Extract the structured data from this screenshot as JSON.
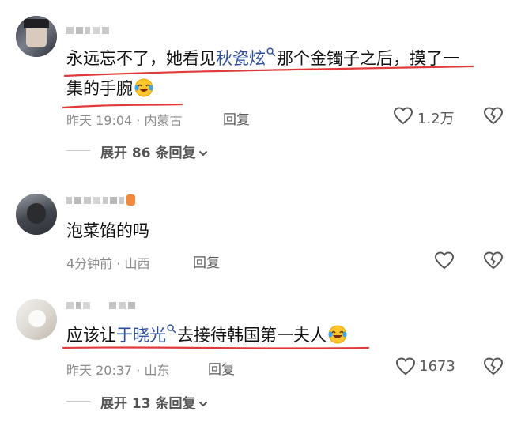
{
  "comments": [
    {
      "text_before": "永远忘不了，她看见",
      "link": "秋瓷炫",
      "text_after_line1": "那个金镯子之后，摸了一",
      "text_line2": "集的手腕",
      "time": "昨天 19:04",
      "location": "内蒙古",
      "reply_label": "回复",
      "likes": "1.2万",
      "expand_label": "展开 86 条回复"
    },
    {
      "text": "泡菜馅的吗",
      "time": "4分钟前",
      "location": "山西",
      "reply_label": "回复"
    },
    {
      "text_before": "应该让",
      "link": "于晓光",
      "text_after": "去接待韩国第一夫人",
      "time": "昨天 20:37",
      "location": "山东",
      "reply_label": "回复",
      "likes": "1673",
      "expand_label": "展开 13 条回复"
    }
  ],
  "icons": {
    "like": "heart-outline-icon",
    "dislike": "broken-heart-icon",
    "search": "search-icon",
    "expand": "chevron-down-icon",
    "emoji": "laughing-tears-emoji"
  },
  "colors": {
    "link": "#2b4f9c",
    "annotation": "#e23a3a"
  }
}
